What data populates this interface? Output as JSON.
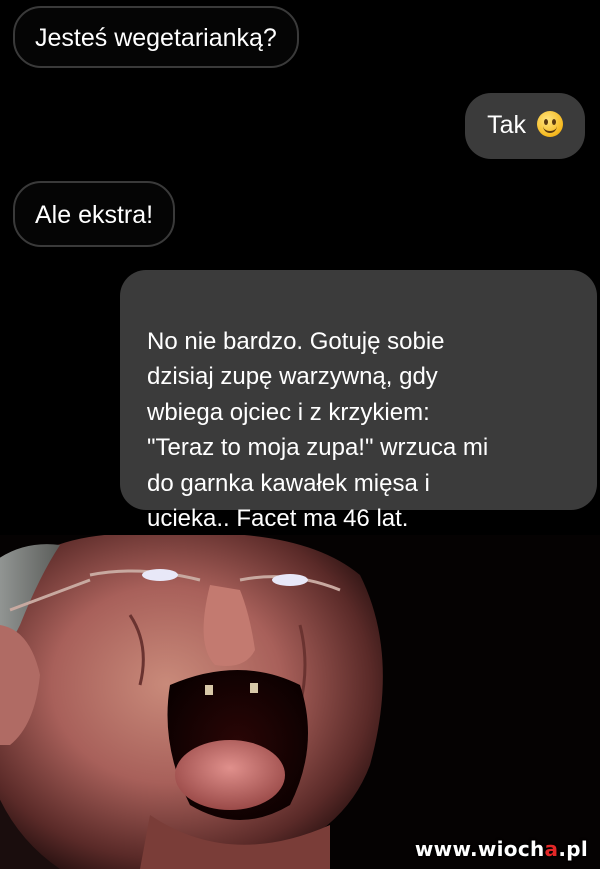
{
  "messages": [
    {
      "sender": "other",
      "text": "Jesteś wegetarianką?"
    },
    {
      "sender": "me",
      "text": "Tak",
      "emoji": "smiling-face-icon"
    },
    {
      "sender": "other",
      "text": "Ale ekstra!"
    },
    {
      "sender": "me",
      "text": "No nie bardzo. Gotuję sobie\ndzisiaj zupę warzywną, gdy\nwbiega ojciec i z krzykiem:\n\"Teraz to moja zupa!\"  wrzuca mi\ndo garnka kawałek mięsa i\nucieka.. Facet ma 46 lat."
    }
  ],
  "photo": {
    "description_icon": "screaming-man-photo"
  },
  "watermark": {
    "prefix": "www.wioch",
    "accent": "a",
    "suffix": ".pl"
  },
  "colors": {
    "background": "#000000",
    "outgoing_bubble": "#3b3b3b",
    "incoming_border": "#3a3a3a",
    "watermark_accent": "#e32727"
  }
}
